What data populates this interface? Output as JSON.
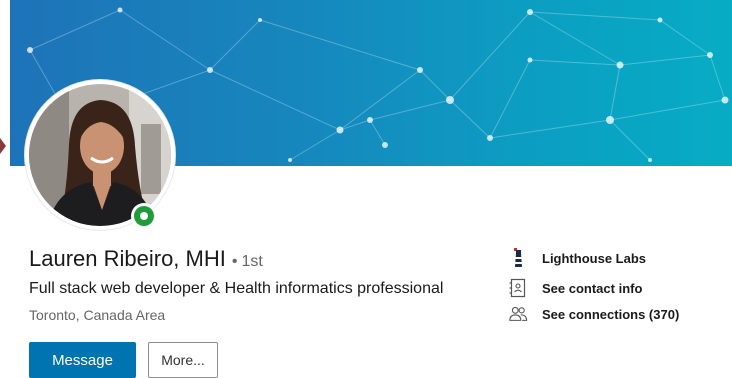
{
  "profile": {
    "name": "Lauren Ribeiro, MHI",
    "degree_separator": "•",
    "degree": "1st",
    "headline": "Full stack web developer & Health informatics professional",
    "location": "Toronto, Canada Area",
    "online_status": "online"
  },
  "actions": {
    "message_label": "Message",
    "more_label": "More..."
  },
  "sidebar": {
    "company": "Lighthouse Labs",
    "contact_info": "See contact info",
    "connections": "See connections (370)"
  },
  "icons": {
    "company": "lighthouse-logo-icon",
    "contact": "contact-card-icon",
    "connections": "people-icon"
  },
  "colors": {
    "primary": "#0073b1",
    "online": "#1f9d3a",
    "banner_start": "#1e73b8",
    "banner_end": "#07acc4"
  }
}
